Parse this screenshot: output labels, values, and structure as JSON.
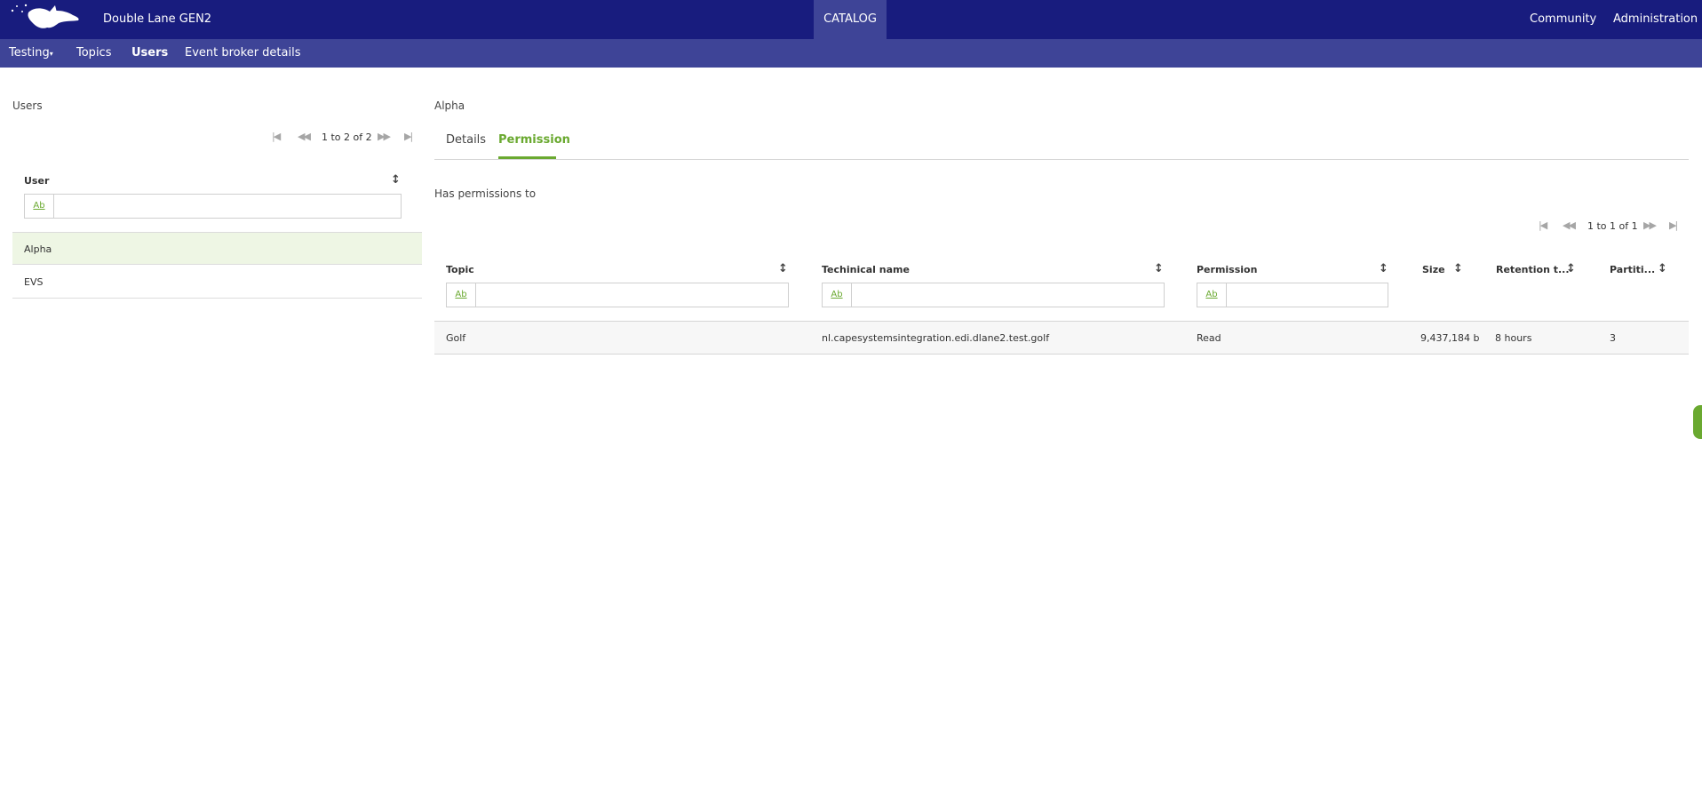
{
  "header": {
    "app_title": "Double Lane GEN2",
    "catalog": "CATALOG",
    "links": [
      "Community",
      "Administration"
    ]
  },
  "subnav": {
    "items": [
      "Testing",
      "Topics",
      "Users",
      "Event broker details"
    ],
    "active": "Users"
  },
  "users_panel": {
    "title": "Users",
    "pager": "1 to 2 of 2",
    "column": "User",
    "filter_badge": "Ab",
    "rows": [
      "Alpha",
      "EVS"
    ],
    "selected": "Alpha"
  },
  "detail": {
    "title": "Alpha",
    "tabs": [
      "Details",
      "Permission"
    ],
    "active_tab": "Permission",
    "subtitle": "Has permissions to",
    "pager": "1 to 1 of 1",
    "columns": [
      "Topic",
      "Techinical name",
      "Permission",
      "Size",
      "Retention t...",
      "Partiti..."
    ],
    "filter_badge": "Ab",
    "rows": [
      {
        "topic": "Golf",
        "technical_name": "nl.capesystemsintegration.edi.dlane2.test.golf",
        "permission": "Read",
        "size": "9,437,184 b",
        "retention": "8 hours",
        "partitions": "3"
      }
    ]
  },
  "colors": {
    "topbar": "#181c7e",
    "subbar": "#3e4497",
    "accent": "#6aa930",
    "selected_row": "#eef6e4"
  },
  "icons": [
    "logo-icon",
    "caret-down-icon",
    "sort-icon",
    "first-page-icon",
    "prev-page-icon",
    "next-page-icon",
    "last-page-icon"
  ]
}
